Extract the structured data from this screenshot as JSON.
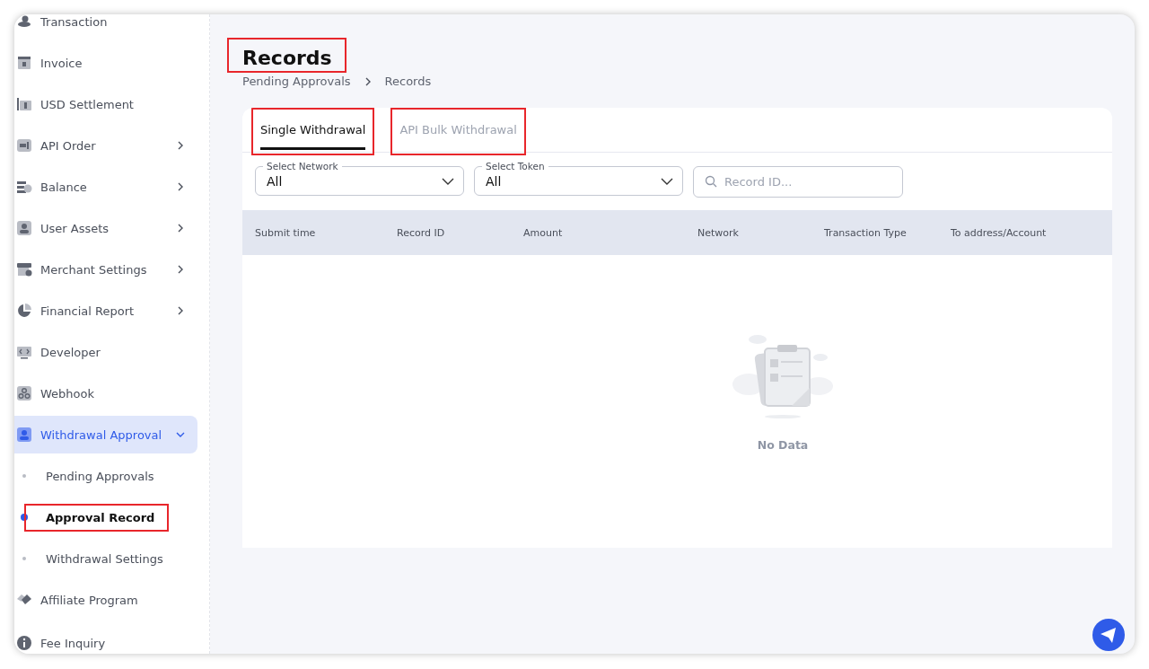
{
  "sidebar": {
    "items": [
      {
        "label": "Transaction",
        "selected": false
      },
      {
        "label": "Invoice",
        "selected": false
      },
      {
        "label": "USD Settlement",
        "selected": false
      },
      {
        "label": "API Order",
        "expanded": false,
        "selected": false
      },
      {
        "label": "Balance",
        "expanded": false,
        "selected": false
      },
      {
        "label": "User Assets",
        "expanded": false,
        "selected": false
      },
      {
        "label": "Merchant Settings",
        "expanded": false,
        "selected": false
      },
      {
        "label": "Financial Report",
        "expanded": false,
        "selected": false
      },
      {
        "label": "Developer",
        "selected": false
      },
      {
        "label": "Webhook",
        "selected": false
      },
      {
        "label": "Withdrawal Approval",
        "expanded": true,
        "selected": true,
        "children": [
          {
            "label": "Pending Approvals",
            "selected": false,
            "highlighted": false
          },
          {
            "label": "Approval Record",
            "selected": true,
            "highlighted": true
          },
          {
            "label": "Withdrawal Settings",
            "selected": false,
            "highlighted": false
          }
        ]
      },
      {
        "label": "Affiliate Program",
        "selected": false
      },
      {
        "label": "Fee Inquiry",
        "selected": false
      }
    ]
  },
  "page": {
    "title": "Records",
    "title_highlighted": true,
    "breadcrumb": [
      "Pending Approvals",
      "Records"
    ]
  },
  "tabs": [
    {
      "label": "Single Withdrawal",
      "selected": true,
      "highlighted": true
    },
    {
      "label": "API Bulk Withdrawal",
      "selected": false,
      "highlighted": true
    }
  ],
  "filters": [
    {
      "label": "Select Network",
      "value": "All"
    },
    {
      "label": "Select Token",
      "value": "All"
    }
  ],
  "search": {
    "placeholder": "Record ID..."
  },
  "table": {
    "columns": [
      "Submit time",
      "Record ID",
      "Amount",
      "Network",
      "Transaction Type",
      "To address/Account"
    ]
  },
  "empty_state": {
    "text": "No Data"
  }
}
